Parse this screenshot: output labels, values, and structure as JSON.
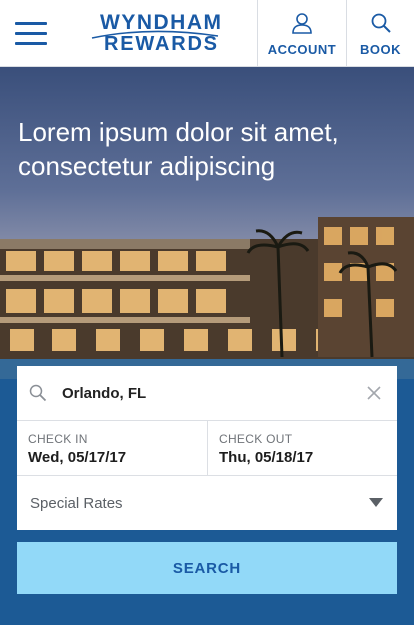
{
  "header": {
    "logo": {
      "line1": "WYNDHAM",
      "line2": "REWARDS",
      "icon": "swoosh-logo"
    },
    "menu_icon": "hamburger-icon",
    "nav": [
      {
        "label": "ACCOUNT",
        "icon": "person-icon"
      },
      {
        "label": "BOOK",
        "icon": "search-icon"
      }
    ]
  },
  "hero": {
    "title": "Lorem ipsum dolor sit amet, consectetur adipiscing"
  },
  "search_form": {
    "location": {
      "value": "Orlando, FL",
      "icon": "search-icon",
      "clear_icon": "close-icon"
    },
    "check_in": {
      "label": "CHECK IN",
      "value": "Wed, 05/17/17"
    },
    "check_out": {
      "label": "CHECK OUT",
      "value": "Thu, 05/18/17"
    },
    "special_rates": {
      "label": "Special Rates",
      "icon": "caret-down-icon"
    },
    "submit_label": "SEARCH"
  },
  "colors": {
    "brand_blue": "#1a5aa5",
    "search_button": "#92d9f8",
    "header_bg": "#ffffff"
  }
}
